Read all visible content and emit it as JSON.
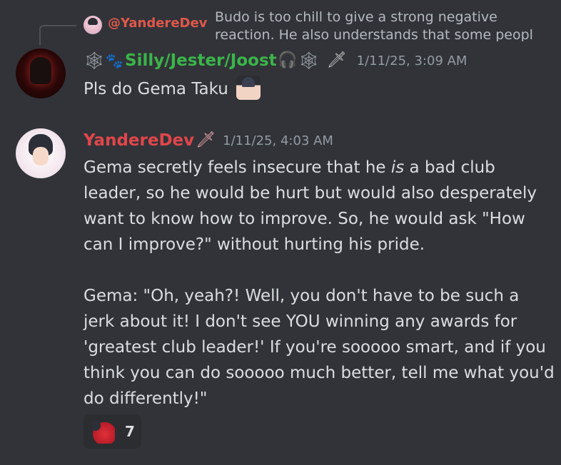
{
  "reply_preview": {
    "author": "@YandereDev",
    "text": "Budo is too chill to give a strong negative reaction. He also understands that some peopl"
  },
  "messages": [
    {
      "author": "Silly/Jester/Joost",
      "timestamp": "1/11/25, 3:09 AM",
      "content": "Pls do Gema Taku",
      "name_decorations": [
        "spiderweb-icon",
        "paw-icon",
        "headphones-icon",
        "spiderweb-icon",
        "knife-icon"
      ],
      "name_color": "#3bb54a"
    },
    {
      "author": "YandereDev",
      "timestamp": "1/11/25, 4:03 AM",
      "content_p1_before": "Gema secretly feels insecure that he ",
      "content_p1_em": "is",
      "content_p1_after": " a bad club leader, so he would be hurt but would also desperately want to know how to improve. So, he would ask \"How can I improve?\" without hurting his pride.",
      "content_p2": "Gema: \"Oh, yeah?! Well, you don't have to be such a jerk about it! I don't see YOU winning any awards for 'greatest club leader!' If you're sooooo smart, and if you think you can do sooooo much better, tell me what you'd do differently!\"",
      "name_color": "#e0464b",
      "reaction": {
        "icon": "heart-character-emoji",
        "count": "7"
      }
    }
  ],
  "colors": {
    "background": "#313338",
    "text": "#dbdee1",
    "muted": "#949ba4",
    "reaction_bg": "#2b2d31"
  }
}
